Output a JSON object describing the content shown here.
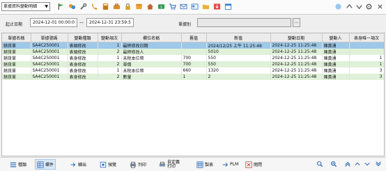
{
  "toolbar": {
    "module_select": "單據資料變動明細",
    "icons": [
      "green-flag-icon",
      "chat-bubbles-icon",
      "wrench-icon",
      "phone-icon",
      "calculator-icon",
      "briefcase-icon",
      "lock-icon",
      "orange-box-icon",
      "home-icon",
      "money-card-icon",
      "cart-icon",
      "mail-icon",
      "card-icon",
      "folder-icon",
      "download-icon",
      "calendar-icon"
    ],
    "right_icons": [
      "chat-icon",
      "up-icon",
      "down-icon",
      "settings-icon",
      "close-icon"
    ]
  },
  "filters": {
    "start_label": "起止日期",
    "start_value": "2024-12-01 00:00:0",
    "dash": "—",
    "end_value": "2024-12-31 23:59:5",
    "doc_type_label": "單據別",
    "doc_type_value": "",
    "more": "..."
  },
  "table": {
    "columns": [
      "單據名稱",
      "單據號碼",
      "變動種類",
      "變動項次",
      "欄位名稱",
      "舊值",
      "新值",
      "變動日期",
      "變動人",
      "表身唯一項次"
    ],
    "rows": [
      {
        "doc_name": "銷貨單",
        "doc_no": "SA4C250001",
        "change_type": "表頭修改",
        "seq": "1",
        "field": "最終修改日期",
        "old": "",
        "new": "2024/12/25 上午 11:25:48",
        "date": "2024-12-25 11:25:48",
        "user": "陳黃湧",
        "line": "",
        "style": "sel"
      },
      {
        "doc_name": "銷貨單",
        "doc_no": "SA4C250001",
        "change_type": "表頭修改",
        "seq": "2",
        "field": "最終修改人",
        "old": "",
        "new": "5010",
        "date": "2024-12-25 11:25:48",
        "user": "陳黃湧",
        "line": "",
        "style": "alt"
      },
      {
        "doc_name": "銷貨單",
        "doc_no": "SA4C250001",
        "change_type": "表身修改",
        "seq": "1",
        "field": "未稅本位幣",
        "old": "700",
        "new": "550",
        "date": "2024-12-25 11:25:48",
        "user": "陳黃湧",
        "line": "1",
        "style": "plain"
      },
      {
        "doc_name": "銷貨單",
        "doc_no": "SA4C250001",
        "change_type": "表身修改",
        "seq": "2",
        "field": "單價",
        "old": "700",
        "new": "550",
        "date": "2024-12-25 11:25:48",
        "user": "陳黃湧",
        "line": "1",
        "style": "alt"
      },
      {
        "doc_name": "銷貨單",
        "doc_no": "SA4C250001",
        "change_type": "表身修改",
        "seq": "1",
        "field": "未稅本位幣",
        "old": "660",
        "new": "1320",
        "date": "2024-12-25 11:25:48",
        "user": "陳黃湧",
        "line": "3",
        "style": "plain"
      },
      {
        "doc_name": "銷貨單",
        "doc_no": "SA4C250001",
        "change_type": "表身修改",
        "seq": "2",
        "field": "數量",
        "old": "1",
        "new": "2",
        "date": "2024-12-25 11:25:48",
        "user": "陳黃湧",
        "line": "3",
        "style": "alt"
      }
    ]
  },
  "footer": {
    "buttons": [
      {
        "label": "種類",
        "icon": "list-icon"
      },
      {
        "label": "欄件",
        "icon": "grid-icon"
      },
      {
        "label": "轉出",
        "icon": "export-icon"
      },
      {
        "label": "預覽",
        "icon": "preview-icon"
      },
      {
        "label": "列印",
        "icon": "print-icon"
      },
      {
        "label": "自定義\n打印",
        "icon": "custom-print-icon"
      },
      {
        "label": "製表",
        "icon": "table-icon"
      },
      {
        "label": "PLM",
        "icon": "plm-icon"
      },
      {
        "label": "閱閉",
        "icon": "close-box-icon"
      }
    ],
    "nav_icons": [
      "search-icon",
      "zoom-in-icon",
      "first-page-icon",
      "prev-page-icon",
      "next-page-icon",
      "last-page-icon"
    ]
  },
  "colors": {
    "selected_row": "#9ec8e8",
    "alt_row": "#dff1d8",
    "accent": "#1f6fb5"
  }
}
